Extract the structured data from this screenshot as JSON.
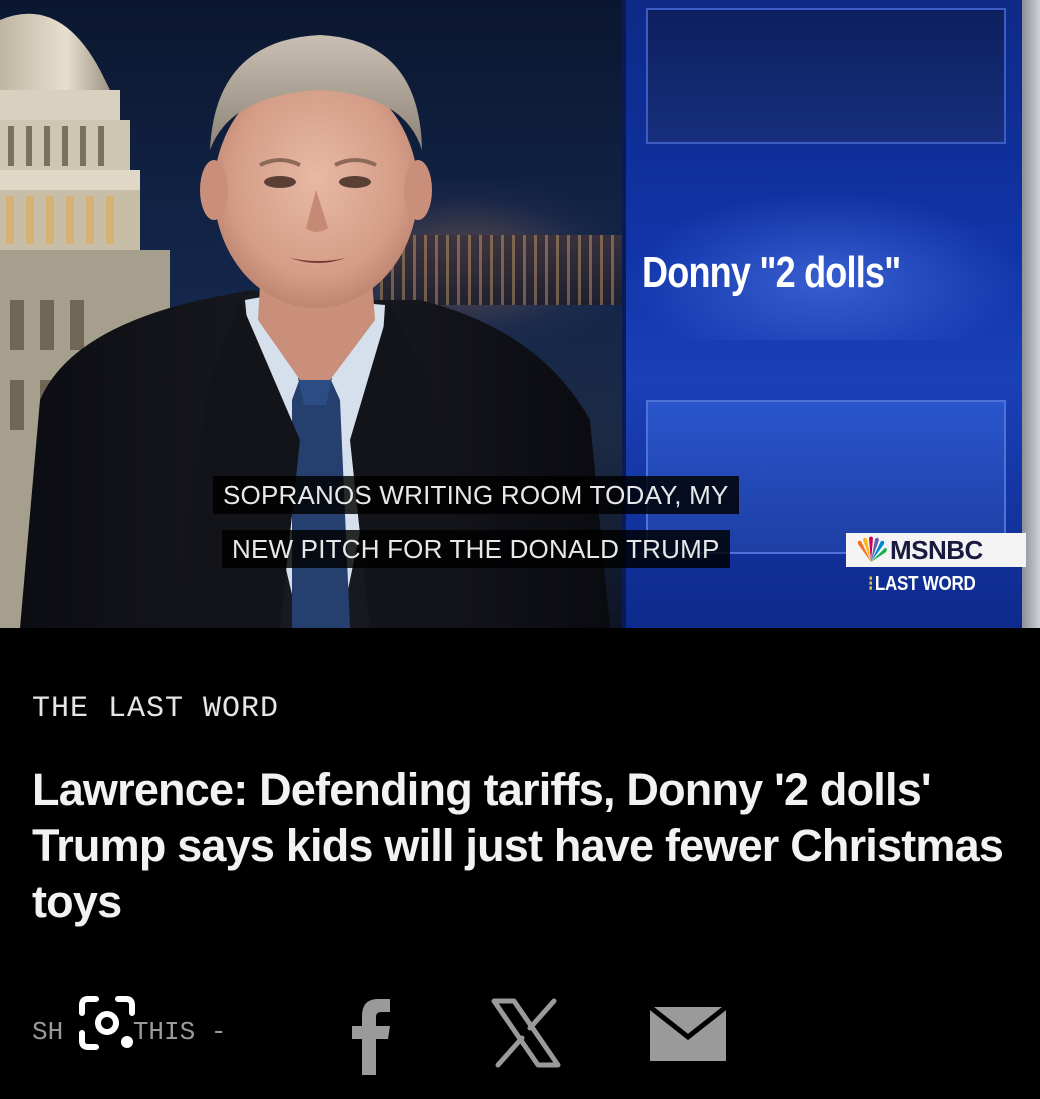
{
  "video": {
    "screen_quote": "Donny \"2 dolls\"",
    "caption_line_1": "SOPRANOS WRITING ROOM TODAY, MY",
    "caption_line_2": "NEW PITCH FOR THE DONALD TRUMP",
    "network_name": "MSNBC",
    "show_bug": "LAST WORD"
  },
  "article": {
    "show_name": "THE LAST WORD",
    "headline": "Lawrence: Defending tariffs, Donny '2 dolls' Trump says kids will just have fewer Christmas toys"
  },
  "share": {
    "label_start": "SH",
    "label_end": "THIS -",
    "icons": [
      "lens-search-icon",
      "facebook-icon",
      "x-icon",
      "email-icon"
    ]
  },
  "colors": {
    "background": "#000000",
    "screen_blue": "#1034a8",
    "headline_text": "#f2f2f2",
    "share_icons": "#9a9a9a"
  }
}
